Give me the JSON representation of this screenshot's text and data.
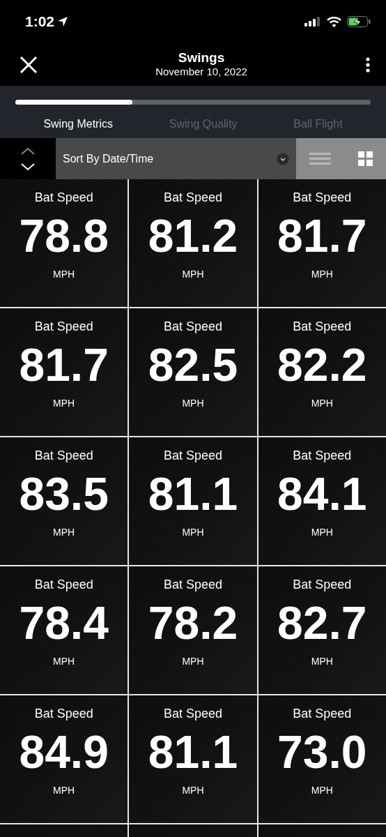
{
  "status_bar": {
    "time": "1:02"
  },
  "header": {
    "title": "Swings",
    "subtitle": "November 10, 2022"
  },
  "progress": {
    "level": 0.33
  },
  "tabs": [
    {
      "label": "Swing Metrics",
      "selected": true
    },
    {
      "label": "Swing Quality",
      "selected": false
    },
    {
      "label": "Ball Flight",
      "selected": false
    }
  ],
  "sort": {
    "label": "Sort By Date/Time"
  },
  "view_modes": [
    {
      "kind": "list",
      "selected": false
    },
    {
      "kind": "grid",
      "selected": true
    }
  ],
  "tiles": [
    {
      "label": "Bat Speed",
      "value": "78.8",
      "unit": "MPH"
    },
    {
      "label": "Bat Speed",
      "value": "81.2",
      "unit": "MPH"
    },
    {
      "label": "Bat Speed",
      "value": "81.7",
      "unit": "MPH"
    },
    {
      "label": "Bat Speed",
      "value": "81.7",
      "unit": "MPH"
    },
    {
      "label": "Bat Speed",
      "value": "82.5",
      "unit": "MPH"
    },
    {
      "label": "Bat Speed",
      "value": "82.2",
      "unit": "MPH"
    },
    {
      "label": "Bat Speed",
      "value": "83.5",
      "unit": "MPH"
    },
    {
      "label": "Bat Speed",
      "value": "81.1",
      "unit": "MPH"
    },
    {
      "label": "Bat Speed",
      "value": "84.1",
      "unit": "MPH"
    },
    {
      "label": "Bat Speed",
      "value": "78.4",
      "unit": "MPH"
    },
    {
      "label": "Bat Speed",
      "value": "78.2",
      "unit": "MPH"
    },
    {
      "label": "Bat Speed",
      "value": "82.7",
      "unit": "MPH"
    },
    {
      "label": "Bat Speed",
      "value": "84.9",
      "unit": "MPH"
    },
    {
      "label": "Bat Speed",
      "value": "81.1",
      "unit": "MPH"
    },
    {
      "label": "Bat Speed",
      "value": "73.0",
      "unit": "MPH"
    }
  ]
}
